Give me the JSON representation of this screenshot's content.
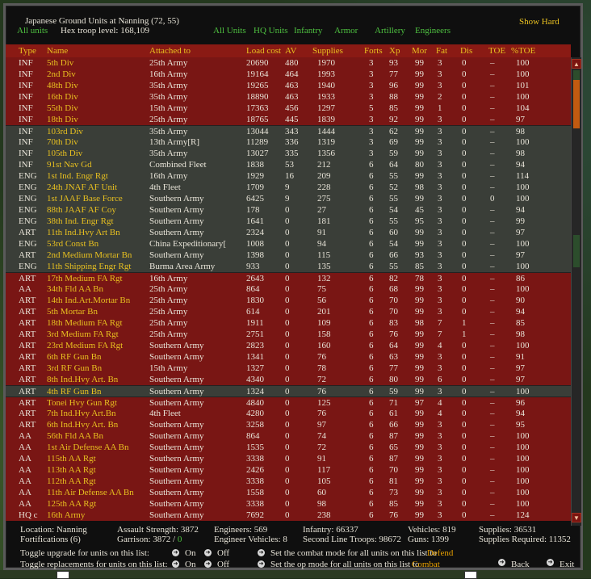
{
  "header": {
    "title": "Japanese Ground Units at Nanning",
    "coords": "(72, 55)",
    "show_hard": "Show Hard",
    "all_units": "All units",
    "hex_troop_level_label": "Hex troop level:",
    "hex_troop_level_value": "168,109",
    "filters": [
      "All Units",
      "HQ Units",
      "Infantry",
      "Armor",
      "Artillery",
      "Engineers"
    ]
  },
  "columns": [
    "Type",
    "Name",
    "Attached to",
    "Load cost",
    "AV",
    "Supplies",
    "Forts",
    "Xp",
    "Mor",
    "Fat",
    "Dis",
    "TOE",
    "%TOE"
  ],
  "rows": [
    {
      "type": "INF",
      "name": "5th Div",
      "attached": "25th Army",
      "load": "20690",
      "av": "480",
      "sup": "1970",
      "forts": "3",
      "xp": "93",
      "mor": "99",
      "fat": "3",
      "dis": "0",
      "toe": "–",
      "ptoe": "100",
      "band": "red"
    },
    {
      "type": "INF",
      "name": "2nd Div",
      "attached": "16th Army",
      "load": "19164",
      "av": "464",
      "sup": "1993",
      "forts": "3",
      "xp": "77",
      "mor": "99",
      "fat": "3",
      "dis": "0",
      "toe": "–",
      "ptoe": "100",
      "band": "red"
    },
    {
      "type": "INF",
      "name": "48th Div",
      "attached": "35th Army",
      "load": "19265",
      "av": "463",
      "sup": "1940",
      "forts": "3",
      "xp": "96",
      "mor": "99",
      "fat": "3",
      "dis": "0",
      "toe": "–",
      "ptoe": "101",
      "band": "red"
    },
    {
      "type": "INF",
      "name": "16th Div",
      "attached": "35th Army",
      "load": "18890",
      "av": "463",
      "sup": "1933",
      "forts": "3",
      "xp": "88",
      "mor": "99",
      "fat": "2",
      "dis": "0",
      "toe": "–",
      "ptoe": "100",
      "band": "red"
    },
    {
      "type": "INF",
      "name": "55th Div",
      "attached": "15th Army",
      "load": "17363",
      "av": "456",
      "sup": "1297",
      "forts": "5",
      "xp": "85",
      "mor": "99",
      "fat": "1",
      "dis": "0",
      "toe": "–",
      "ptoe": "104",
      "band": "red"
    },
    {
      "type": "INF",
      "name": "18th Div",
      "attached": "25th Army",
      "load": "18765",
      "av": "445",
      "sup": "1839",
      "forts": "3",
      "xp": "92",
      "mor": "99",
      "fat": "3",
      "dis": "0",
      "toe": "–",
      "ptoe": "97",
      "band": "red"
    },
    {
      "type": "INF",
      "name": "103rd Div",
      "attached": "35th Army",
      "load": "13044",
      "av": "343",
      "sup": "1444",
      "forts": "3",
      "xp": "62",
      "mor": "99",
      "fat": "3",
      "dis": "0",
      "toe": "–",
      "ptoe": "98",
      "band": "gray"
    },
    {
      "type": "INF",
      "name": "70th Div",
      "attached": "13th Army[R]",
      "load": "11289",
      "av": "336",
      "sup": "1319",
      "forts": "3",
      "xp": "69",
      "mor": "99",
      "fat": "3",
      "dis": "0",
      "toe": "–",
      "ptoe": "100",
      "band": "gray"
    },
    {
      "type": "INF",
      "name": "105th Div",
      "attached": "35th Army",
      "load": "13027",
      "av": "335",
      "sup": "1356",
      "forts": "3",
      "xp": "59",
      "mor": "99",
      "fat": "3",
      "dis": "0",
      "toe": "–",
      "ptoe": "98",
      "band": "gray"
    },
    {
      "type": "INF",
      "name": "91st Nav Gd",
      "attached": "Combined Fleet",
      "load": "1838",
      "av": "53",
      "sup": "212",
      "forts": "6",
      "xp": "64",
      "mor": "80",
      "fat": "3",
      "dis": "0",
      "toe": "–",
      "ptoe": "94",
      "band": "gray"
    },
    {
      "type": "ENG",
      "name": "1st Ind. Engr Rgt",
      "attached": "16th Army",
      "load": "1929",
      "av": "16",
      "sup": "209",
      "forts": "6",
      "xp": "55",
      "mor": "99",
      "fat": "3",
      "dis": "0",
      "toe": "–",
      "ptoe": "114",
      "band": "gray"
    },
    {
      "type": "ENG",
      "name": "24th JNAF AF Unit",
      "attached": "4th Fleet",
      "load": "1709",
      "av": "9",
      "sup": "228",
      "forts": "6",
      "xp": "52",
      "mor": "98",
      "fat": "3",
      "dis": "0",
      "toe": "–",
      "ptoe": "100",
      "band": "gray"
    },
    {
      "type": "ENG",
      "name": "1st JAAF Base Force",
      "attached": "Southern Army",
      "load": "6425",
      "av": "9",
      "sup": "275",
      "forts": "6",
      "xp": "55",
      "mor": "99",
      "fat": "3",
      "dis": "0",
      "toe": "0",
      "ptoe": "100",
      "band": "gray"
    },
    {
      "type": "ENG",
      "name": "88th JAAF AF Coy",
      "attached": "Southern Army",
      "load": "178",
      "av": "0",
      "sup": "27",
      "forts": "6",
      "xp": "54",
      "mor": "45",
      "fat": "3",
      "dis": "0",
      "toe": "–",
      "ptoe": "94",
      "band": "gray"
    },
    {
      "type": "ENG",
      "name": "38th Ind. Engr Rgt",
      "attached": "Southern Army",
      "load": "1641",
      "av": "0",
      "sup": "181",
      "forts": "6",
      "xp": "55",
      "mor": "95",
      "fat": "3",
      "dis": "0",
      "toe": "–",
      "ptoe": "99",
      "band": "gray"
    },
    {
      "type": "ART",
      "name": "11th Ind.Hvy Art Bn",
      "attached": "Southern Army",
      "load": "2324",
      "av": "0",
      "sup": "91",
      "forts": "6",
      "xp": "60",
      "mor": "99",
      "fat": "3",
      "dis": "0",
      "toe": "–",
      "ptoe": "97",
      "band": "gray"
    },
    {
      "type": "ENG",
      "name": "53rd Const Bn",
      "attached": "China Expeditionary[",
      "load": "1008",
      "av": "0",
      "sup": "94",
      "forts": "6",
      "xp": "54",
      "mor": "99",
      "fat": "3",
      "dis": "0",
      "toe": "–",
      "ptoe": "100",
      "band": "gray"
    },
    {
      "type": "ART",
      "name": "2nd Medium Mortar Bn",
      "attached": "Southern Army",
      "load": "1398",
      "av": "0",
      "sup": "115",
      "forts": "6",
      "xp": "66",
      "mor": "93",
      "fat": "3",
      "dis": "0",
      "toe": "–",
      "ptoe": "97",
      "band": "gray"
    },
    {
      "type": "ENG",
      "name": "11th Shipping Engr Rgt",
      "attached": "Burma Area Army",
      "load": "933",
      "av": "0",
      "sup": "135",
      "forts": "6",
      "xp": "55",
      "mor": "85",
      "fat": "3",
      "dis": "0",
      "toe": "–",
      "ptoe": "100",
      "band": "gray"
    },
    {
      "type": "ART",
      "name": "17th Medium FA Rgt",
      "attached": "16th Army",
      "load": "2643",
      "av": "0",
      "sup": "132",
      "forts": "6",
      "xp": "82",
      "mor": "78",
      "fat": "3",
      "dis": "0",
      "toe": "–",
      "ptoe": "86",
      "band": "red"
    },
    {
      "type": "AA",
      "name": "34th Fld AA Bn",
      "attached": "25th Army",
      "load": "864",
      "av": "0",
      "sup": "75",
      "forts": "6",
      "xp": "68",
      "mor": "99",
      "fat": "3",
      "dis": "0",
      "toe": "–",
      "ptoe": "100",
      "band": "red"
    },
    {
      "type": "ART",
      "name": "14th Ind.Art.Mortar Bn",
      "attached": "25th Army",
      "load": "1830",
      "av": "0",
      "sup": "56",
      "forts": "6",
      "xp": "70",
      "mor": "99",
      "fat": "3",
      "dis": "0",
      "toe": "–",
      "ptoe": "90",
      "band": "red"
    },
    {
      "type": "ART",
      "name": "5th Mortar Bn",
      "attached": "25th Army",
      "load": "614",
      "av": "0",
      "sup": "201",
      "forts": "6",
      "xp": "70",
      "mor": "99",
      "fat": "3",
      "dis": "0",
      "toe": "–",
      "ptoe": "94",
      "band": "red"
    },
    {
      "type": "ART",
      "name": "18th Medium FA Rgt",
      "attached": "25th Army",
      "load": "1911",
      "av": "0",
      "sup": "109",
      "forts": "6",
      "xp": "83",
      "mor": "98",
      "fat": "7",
      "dis": "1",
      "toe": "–",
      "ptoe": "85",
      "band": "red"
    },
    {
      "type": "ART",
      "name": "3rd Medium FA Rgt",
      "attached": "25th Army",
      "load": "2751",
      "av": "0",
      "sup": "158",
      "forts": "6",
      "xp": "76",
      "mor": "99",
      "fat": "7",
      "dis": "1",
      "toe": "–",
      "ptoe": "98",
      "band": "red"
    },
    {
      "type": "ART",
      "name": "23rd Medium FA Rgt",
      "attached": "Southern Army",
      "load": "2823",
      "av": "0",
      "sup": "160",
      "forts": "6",
      "xp": "64",
      "mor": "99",
      "fat": "4",
      "dis": "0",
      "toe": "–",
      "ptoe": "100",
      "band": "red"
    },
    {
      "type": "ART",
      "name": "6th RF Gun Bn",
      "attached": "Southern Army",
      "load": "1341",
      "av": "0",
      "sup": "76",
      "forts": "6",
      "xp": "63",
      "mor": "99",
      "fat": "3",
      "dis": "0",
      "toe": "–",
      "ptoe": "91",
      "band": "red"
    },
    {
      "type": "ART",
      "name": "3rd RF Gun Bn",
      "attached": "15th Army",
      "load": "1327",
      "av": "0",
      "sup": "78",
      "forts": "6",
      "xp": "77",
      "mor": "99",
      "fat": "3",
      "dis": "0",
      "toe": "–",
      "ptoe": "97",
      "band": "red"
    },
    {
      "type": "ART",
      "name": "8th Ind.Hvy Art. Bn",
      "attached": "Southern Army",
      "load": "4340",
      "av": "0",
      "sup": "72",
      "forts": "6",
      "xp": "80",
      "mor": "99",
      "fat": "6",
      "dis": "0",
      "toe": "–",
      "ptoe": "97",
      "band": "red"
    },
    {
      "type": "ART",
      "name": "4th RF Gun Bn",
      "attached": "Southern Army",
      "load": "1324",
      "av": "0",
      "sup": "76",
      "forts": "6",
      "xp": "59",
      "mor": "99",
      "fat": "3",
      "dis": "0",
      "toe": "–",
      "ptoe": "100",
      "band": "gray"
    },
    {
      "type": "ART",
      "name": "Tonei Hvy Gun Rgt",
      "attached": "Southern Army",
      "load": "4840",
      "av": "0",
      "sup": "125",
      "forts": "6",
      "xp": "71",
      "mor": "97",
      "fat": "4",
      "dis": "0",
      "toe": "–",
      "ptoe": "96",
      "band": "red"
    },
    {
      "type": "ART",
      "name": "7th Ind.Hvy Art.Bn",
      "attached": "4th Fleet",
      "load": "4280",
      "av": "0",
      "sup": "76",
      "forts": "6",
      "xp": "61",
      "mor": "99",
      "fat": "4",
      "dis": "0",
      "toe": "–",
      "ptoe": "94",
      "band": "red"
    },
    {
      "type": "ART",
      "name": "6th Ind.Hvy Art. Bn",
      "attached": "Southern Army",
      "load": "3258",
      "av": "0",
      "sup": "97",
      "forts": "6",
      "xp": "66",
      "mor": "99",
      "fat": "3",
      "dis": "0",
      "toe": "–",
      "ptoe": "95",
      "band": "red"
    },
    {
      "type": "AA",
      "name": "56th Fld AA Bn",
      "attached": "Southern Army",
      "load": "864",
      "av": "0",
      "sup": "74",
      "forts": "6",
      "xp": "87",
      "mor": "99",
      "fat": "3",
      "dis": "0",
      "toe": "–",
      "ptoe": "100",
      "band": "red"
    },
    {
      "type": "AA",
      "name": "1st Air Defense AA Bn",
      "attached": "Southern Army",
      "load": "1535",
      "av": "0",
      "sup": "72",
      "forts": "6",
      "xp": "65",
      "mor": "99",
      "fat": "3",
      "dis": "0",
      "toe": "–",
      "ptoe": "100",
      "band": "red"
    },
    {
      "type": "AA",
      "name": "115th AA Rgt",
      "attached": "Southern Army",
      "load": "3338",
      "av": "0",
      "sup": "91",
      "forts": "6",
      "xp": "87",
      "mor": "99",
      "fat": "3",
      "dis": "0",
      "toe": "–",
      "ptoe": "100",
      "band": "red"
    },
    {
      "type": "AA",
      "name": "113th AA Rgt",
      "attached": "Southern Army",
      "load": "2426",
      "av": "0",
      "sup": "117",
      "forts": "6",
      "xp": "70",
      "mor": "99",
      "fat": "3",
      "dis": "0",
      "toe": "–",
      "ptoe": "100",
      "band": "red"
    },
    {
      "type": "AA",
      "name": "112th AA Rgt",
      "attached": "Southern Army",
      "load": "3338",
      "av": "0",
      "sup": "105",
      "forts": "6",
      "xp": "81",
      "mor": "99",
      "fat": "3",
      "dis": "0",
      "toe": "–",
      "ptoe": "100",
      "band": "red"
    },
    {
      "type": "AA",
      "name": "11th Air Defense AA Bn",
      "attached": "Southern Army",
      "load": "1558",
      "av": "0",
      "sup": "60",
      "forts": "6",
      "xp": "73",
      "mor": "99",
      "fat": "3",
      "dis": "0",
      "toe": "–",
      "ptoe": "100",
      "band": "red"
    },
    {
      "type": "AA",
      "name": "125th AA Rgt",
      "attached": "Southern Army",
      "load": "3338",
      "av": "0",
      "sup": "98",
      "forts": "6",
      "xp": "85",
      "mor": "99",
      "fat": "3",
      "dis": "0",
      "toe": "–",
      "ptoe": "100",
      "band": "red"
    },
    {
      "type": "HQ c",
      "name": "16th Army",
      "attached": "Southern Army",
      "load": "7692",
      "av": "0",
      "sup": "238",
      "forts": "6",
      "xp": "76",
      "mor": "99",
      "fat": "3",
      "dis": "0",
      "toe": "–",
      "ptoe": "124",
      "band": "red"
    }
  ],
  "footer": {
    "location": "Location: Nanning",
    "fortifications": "Fortifications (6)",
    "assault_strength": "Assault Strength: 3872",
    "garrison_label": "Garrison: 3872 /",
    "garrison_value": "0",
    "engineers": "Engineers: 569",
    "engineer_vehicles": "Engineer Vehicles: 8",
    "infantry": "Infantry: 66337",
    "second_line": "Second Line Troops: 98672",
    "vehicles": "Vehicles: 819",
    "guns": "Guns: 1399",
    "supplies": "Supplies: 36531",
    "supplies_required": "Supplies Required: 11352",
    "toggle_upgrade": "Toggle upgrade for units on this list:",
    "toggle_replacements": "Toggle replacements for units on this list:",
    "on": "On",
    "off": "Off",
    "combat_mode_text": "Set the combat mode for all units on this list to",
    "combat_mode_value": "Defend",
    "op_mode_text": "Set the op mode for all units on this list to",
    "op_mode_value": "Combat",
    "back": "Back",
    "exit": "Exit"
  },
  "colors": {
    "red_band": "#791614",
    "gray_band": "#3a3e38",
    "yellow": "#e8c020",
    "green": "#4ec040",
    "orange": "#e8a000"
  }
}
